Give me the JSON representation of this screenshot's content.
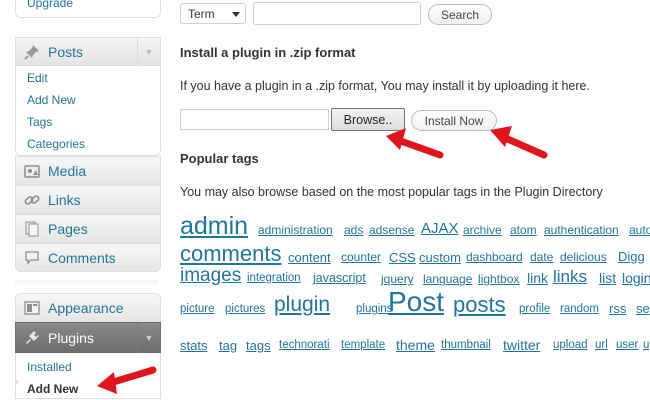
{
  "sidebar": {
    "upgrade_label": "Upgrade",
    "posts": {
      "label": "Posts",
      "icon": "pin-icon",
      "items": [
        "Edit",
        "Add New",
        "Tags",
        "Categories"
      ]
    },
    "media_label": "Media",
    "links_label": "Links",
    "pages_label": "Pages",
    "comments_label": "Comments",
    "appearance_label": "Appearance",
    "plugins": {
      "label": "Plugins",
      "items": [
        "Installed",
        "Add New"
      ]
    }
  },
  "search": {
    "select_value": "Term",
    "input_value": "",
    "button_label": "Search"
  },
  "upload": {
    "heading": "Install a plugin in .zip format",
    "description": "If you have a plugin in a .zip format, You may install it by uploading it here.",
    "file_value": "",
    "browse_label": "Browse..",
    "install_label": "Install Now"
  },
  "tags": {
    "heading": "Popular tags",
    "description": "You may also browse based on the most popular tags in the Plugin Directory",
    "rows": [
      [
        "admin",
        "administration",
        "ads",
        "adsense",
        "AJAX",
        "archive",
        "atom",
        "authentication",
        "auto"
      ],
      [
        "comments",
        "content",
        "counter",
        "CSS",
        "custom",
        "dashboard",
        "date",
        "delicious",
        "Digg"
      ],
      [
        "images",
        "integration",
        "javascript",
        "jquery",
        "language",
        "lightbox",
        "link",
        "links",
        "list",
        "login"
      ],
      [
        "picture",
        "pictures",
        "plugin",
        "plugins",
        "Post",
        "posts",
        "profile",
        "random",
        "rss",
        "se"
      ],
      [
        "stats",
        "tag",
        "tags",
        "technorati",
        "template",
        "theme",
        "thumbnail",
        "twitter",
        "upload",
        "url",
        "user",
        "u"
      ]
    ]
  },
  "colors": {
    "link": "#21759b",
    "arrow": "#e0161c",
    "active_menu": "#6d6d6d"
  }
}
